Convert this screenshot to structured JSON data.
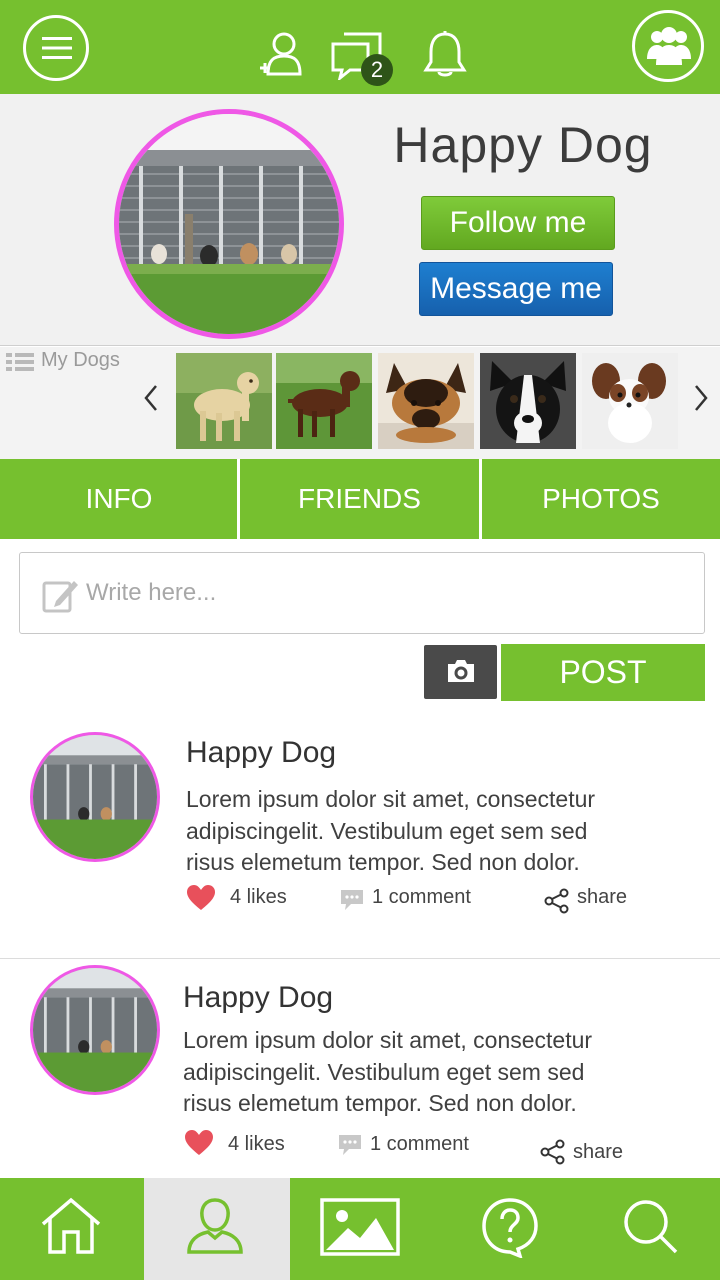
{
  "topbar": {
    "icons": [
      "menu-icon",
      "add-friend-icon",
      "messages-icon",
      "notifications-icon",
      "group-icon"
    ],
    "message_badge": "2"
  },
  "profile": {
    "name": "Happy Dog",
    "follow_label": "Follow me",
    "message_label": "Message me"
  },
  "dogs": {
    "label": "My Dogs",
    "count": 5
  },
  "tabs": [
    {
      "label": "INFO"
    },
    {
      "label": "FRIENDS"
    },
    {
      "label": "PHOTOS"
    }
  ],
  "composer": {
    "placeholder": "Write here...",
    "post_label": "POST"
  },
  "posts": [
    {
      "author": "Happy Dog",
      "text": "Lorem ipsum dolor sit amet, consectetur adipiscingelit. Vestibulum eget sem sed risus elemetum tempor. Sed non dolor.",
      "likes": "4 likes",
      "comments": "1 comment",
      "share": "share"
    },
    {
      "author": "Happy Dog",
      "text": "Lorem ipsum dolor sit amet, consectetur adipiscingelit. Vestibulum eget sem sed risus elemetum tempor. Sed non dolor.",
      "likes": "4 likes",
      "comments": "1 comment",
      "share": "share"
    }
  ],
  "bottom_nav": {
    "items": [
      "home-icon",
      "profile-icon",
      "gallery-icon",
      "help-icon",
      "search-icon"
    ],
    "active": "profile-icon"
  },
  "colors": {
    "brand_green": "#76c02f",
    "follow_green": "#6cb82a",
    "message_blue": "#1a6fc0",
    "avatar_ring": "#ef58e6",
    "like_red": "#e8505b",
    "camera_dark": "#4a4a4a"
  }
}
